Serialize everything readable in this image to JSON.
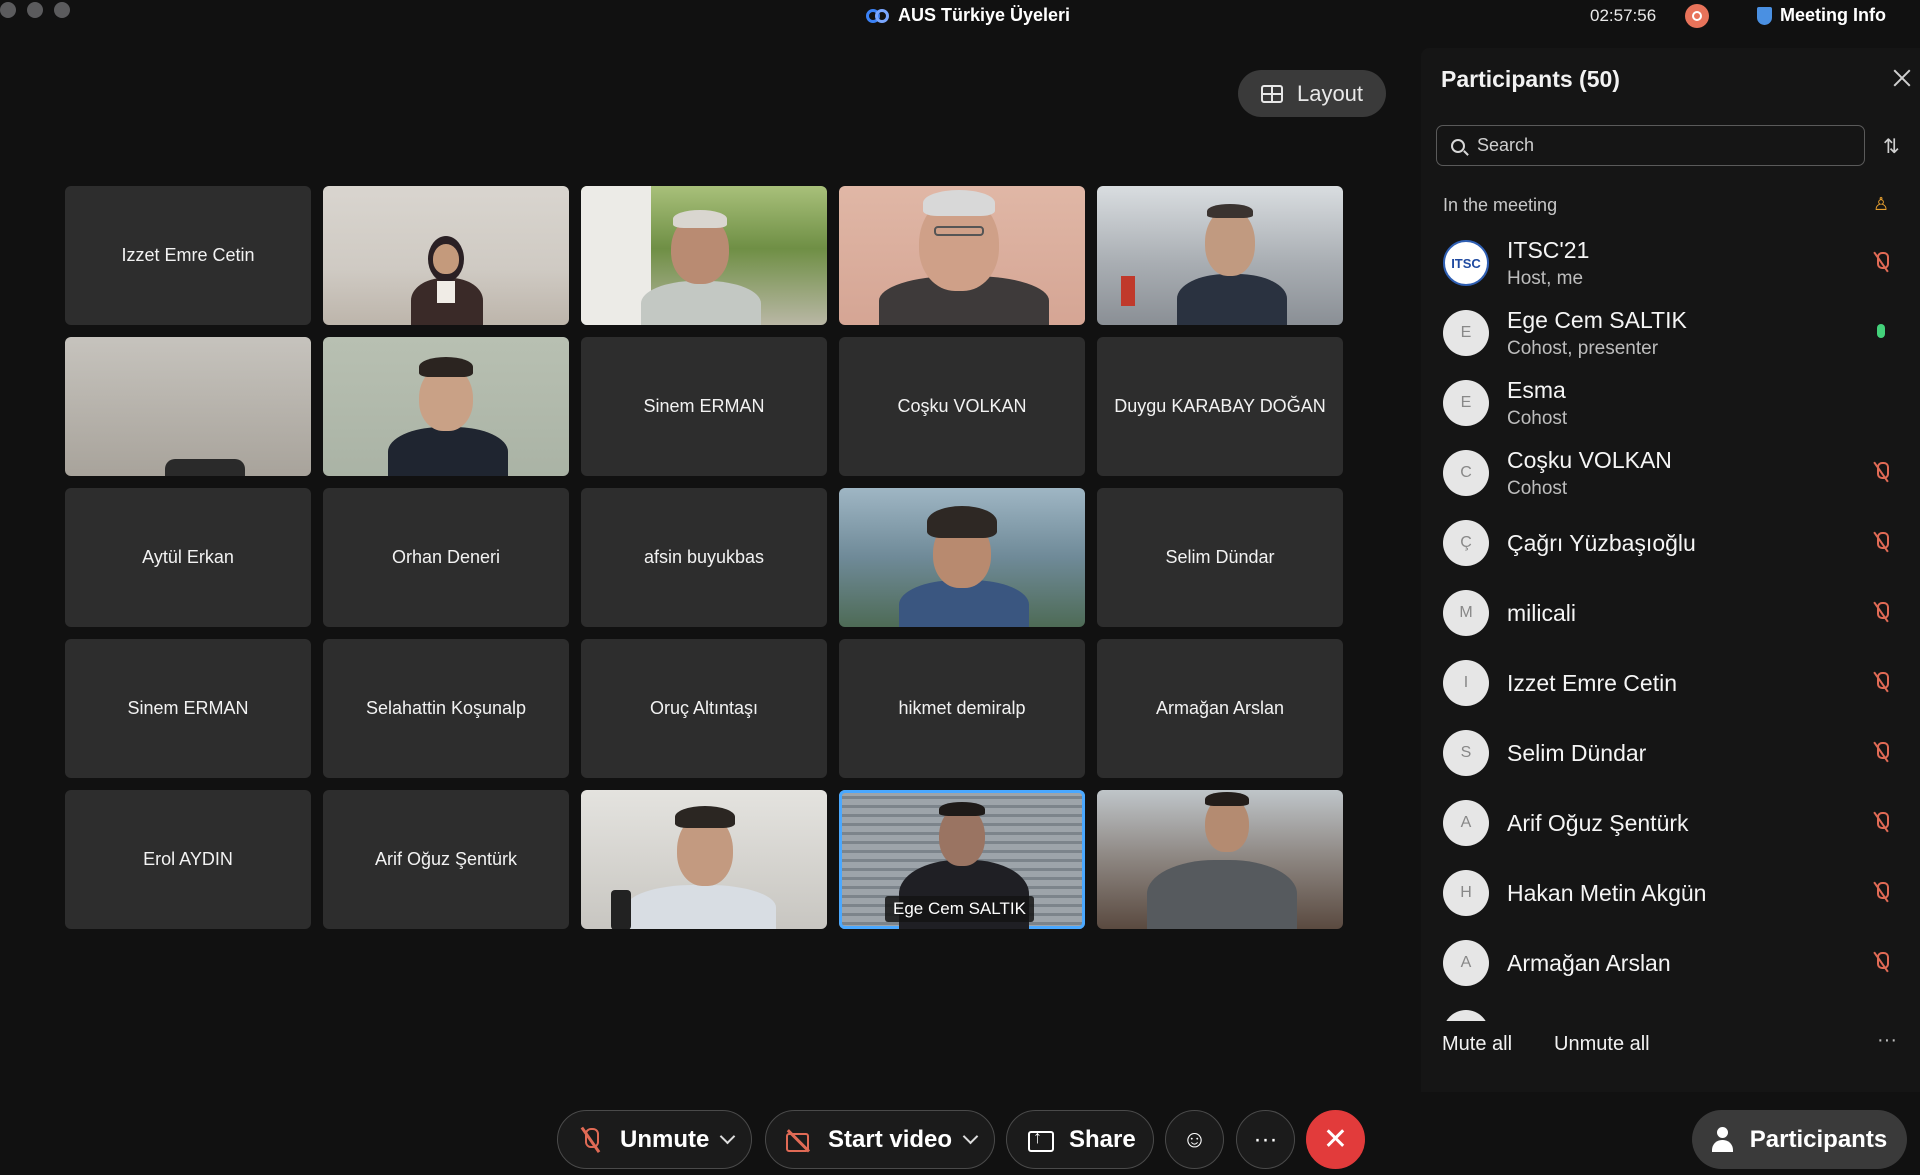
{
  "window": {
    "title": "AUS Türkiye Üyeleri",
    "clock": "02:57:56",
    "meeting_info_label": "Meeting Info"
  },
  "layout_label": "Layout",
  "tiles": [
    {
      "name": "Izzet Emre Cetin",
      "video": false
    },
    {
      "name": "",
      "video": true
    },
    {
      "name": "",
      "video": true
    },
    {
      "name": "",
      "video": true
    },
    {
      "name": "",
      "video": true
    },
    {
      "name": "",
      "video": true
    },
    {
      "name": "",
      "video": true
    },
    {
      "name": "Sinem ERMAN",
      "video": false
    },
    {
      "name": "Coşku VOLKAN",
      "video": false
    },
    {
      "name": "Duygu KARABAY DOĞAN",
      "video": false
    },
    {
      "name": "Aytül Erkan",
      "video": false
    },
    {
      "name": "Orhan Deneri",
      "video": false
    },
    {
      "name": "afsin buyukbas",
      "video": false
    },
    {
      "name": "",
      "video": true
    },
    {
      "name": "Selim Dündar",
      "video": false
    },
    {
      "name": "Sinem ERMAN",
      "video": false
    },
    {
      "name": "Selahattin Koşunalp",
      "video": false
    },
    {
      "name": "Oruç Altıntaşı",
      "video": false
    },
    {
      "name": "hikmet demiralp",
      "video": false
    },
    {
      "name": "Armağan Arslan",
      "video": false
    },
    {
      "name": "Erol AYDIN",
      "video": false
    },
    {
      "name": "Arif Oğuz Şentürk",
      "video": false
    },
    {
      "name": "",
      "video": true
    },
    {
      "name": "",
      "video": true,
      "speaking": true,
      "label": "Ege Cem SALTIK"
    },
    {
      "name": "",
      "video": true
    }
  ],
  "participants_panel": {
    "title": "Participants (50)",
    "search_placeholder": "Search",
    "section_label": "In the meeting",
    "participants": [
      {
        "name": "ITSC'21",
        "role": "Host, me",
        "initial": "ITSC",
        "mic": "muted"
      },
      {
        "name": "Ege Cem SALTIK",
        "role": "Cohost, presenter",
        "initial": "E",
        "mic": "active"
      },
      {
        "name": "Esma",
        "role": "Cohost",
        "initial": "E",
        "mic": "none"
      },
      {
        "name": "Coşku VOLKAN",
        "role": "Cohost",
        "initial": "C",
        "mic": "muted"
      },
      {
        "name": "Çağrı Yüzbaşıoğlu",
        "role": "",
        "initial": "Ç",
        "mic": "muted"
      },
      {
        "name": "milicali",
        "role": "",
        "initial": "M",
        "mic": "muted"
      },
      {
        "name": "Izzet Emre Cetin",
        "role": "",
        "initial": "I",
        "mic": "muted"
      },
      {
        "name": "Selim Dündar",
        "role": "",
        "initial": "S",
        "mic": "muted"
      },
      {
        "name": "Arif Oğuz Şentürk",
        "role": "",
        "initial": "A",
        "mic": "muted"
      },
      {
        "name": "Hakan Metin Akgün",
        "role": "",
        "initial": "H",
        "mic": "muted"
      },
      {
        "name": "Armağan Arslan",
        "role": "",
        "initial": "A",
        "mic": "muted"
      }
    ],
    "mute_all_label": "Mute all",
    "unmute_all_label": "Unmute all",
    "more_label": "···"
  },
  "toolbar": {
    "unmute_label": "Unmute",
    "start_video_label": "Start video",
    "share_label": "Share",
    "more_label": "···",
    "participants_label": "Participants"
  },
  "colors": {
    "background": "#111111",
    "tile": "#2d2d2d",
    "speaker_outline": "#4aa8ff",
    "muted_icon": "#e06a55",
    "leave": "#e23b3b",
    "unmuted_icon": "#43d17a"
  }
}
